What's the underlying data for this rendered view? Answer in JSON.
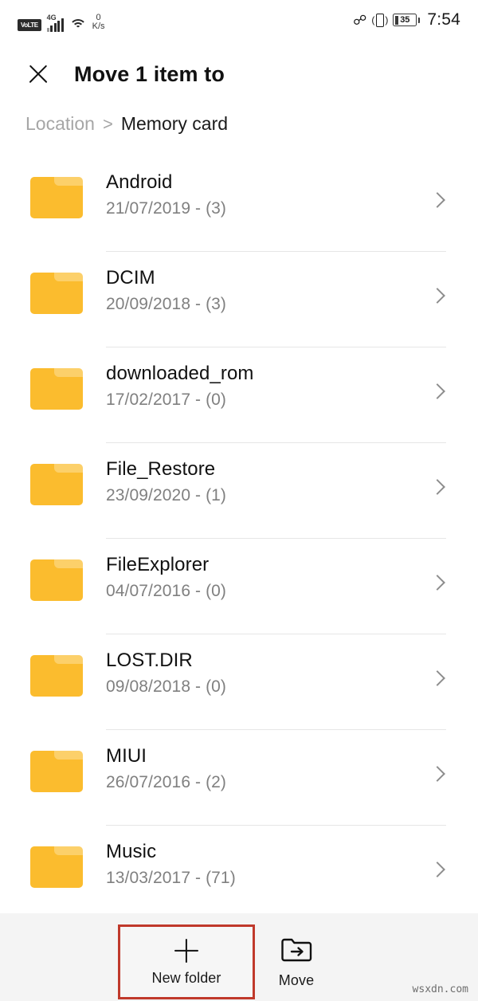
{
  "status_bar": {
    "volte_label": "VoLTE",
    "network_type": "4G",
    "wifi_icon": "wifi-icon",
    "net_speed_value": "0",
    "net_speed_unit": "K/s",
    "bluetooth_icon": "bluetooth-icon",
    "vibrate_icon": "vibrate-icon",
    "battery_percent": "35",
    "time": "7:54"
  },
  "header": {
    "close_icon": "close-icon",
    "title": "Move 1 item to"
  },
  "breadcrumb": {
    "root": "Location",
    "separator": ">",
    "current": "Memory card"
  },
  "list": {
    "rows": [
      {
        "name": "Android",
        "meta": "21/07/2019 - (3)"
      },
      {
        "name": "DCIM",
        "meta": "20/09/2018 - (3)"
      },
      {
        "name": "downloaded_rom",
        "meta": "17/02/2017 - (0)"
      },
      {
        "name": "File_Restore",
        "meta": "23/09/2020 - (1)"
      },
      {
        "name": "FileExplorer",
        "meta": "04/07/2016 - (0)"
      },
      {
        "name": "LOST.DIR",
        "meta": "09/08/2018 - (0)"
      },
      {
        "name": "MIUI",
        "meta": "26/07/2016 - (2)"
      },
      {
        "name": "Music",
        "meta": "13/03/2017 - (71)"
      }
    ]
  },
  "bottom_bar": {
    "new_folder_label": "New folder",
    "new_folder_icon": "plus-icon",
    "move_label": "Move",
    "move_icon": "folder-move-icon"
  },
  "annotation": {
    "highlight_color": "#C0392B"
  },
  "watermark": "wsxdn.com",
  "colors": {
    "folder": "#FBBC2E",
    "folder_tab": "#FCD06A",
    "meta_text": "#808080",
    "divider": "#e6e6e6",
    "bottom_bar_bg": "#F4F4F4"
  }
}
